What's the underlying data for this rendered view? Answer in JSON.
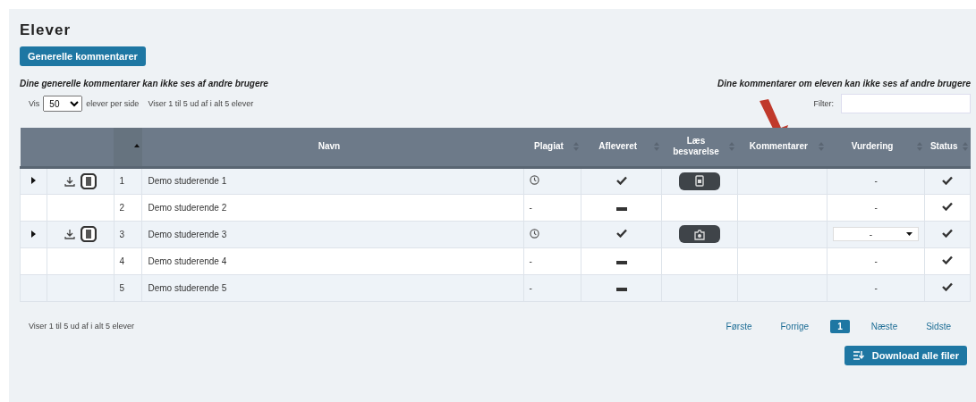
{
  "title": "Elever",
  "general_comments_button": "Generelle kommentarer",
  "notes": {
    "left": "Dine generelle kommentarer kan ikke ses af andre brugere",
    "right": "Dine kommentarer om eleven kan ikke ses af andre brugere"
  },
  "length": {
    "prefix": "Vis",
    "value": "50",
    "suffix": "elever per side",
    "info": "Viser 1 til 5 ud af i alt 5 elever"
  },
  "filter": {
    "label": "Filter:"
  },
  "annotation": {
    "kind": "arrow"
  },
  "columns": [
    {
      "sortable": true,
      "sorted": true
    },
    {
      "label": "Navn",
      "sortable": false
    },
    {
      "label": "Plagiat",
      "sortable": true,
      "sorted": false
    },
    {
      "label": "Afleveret",
      "sortable": true,
      "sorted": false
    },
    {
      "label": "Læs besvarelse",
      "sortable": true,
      "sorted": false
    },
    {
      "label": "Kommentarer",
      "sortable": true,
      "sorted": false
    },
    {
      "label": "Vurdering",
      "sortable": true,
      "sorted": false
    },
    {
      "label": "Status",
      "sortable": true,
      "sorted": false
    }
  ],
  "rows": [
    {
      "expandable": true,
      "files": true,
      "number": "1",
      "name": "Demo studerende 1",
      "plagiat": {
        "kind": "clock"
      },
      "afleveret": {
        "kind": "check"
      },
      "answer": {
        "kind": "document"
      },
      "vurdering": {
        "kind": "text",
        "value": "-"
      },
      "status": {
        "kind": "check"
      }
    },
    {
      "expandable": false,
      "files": false,
      "number": "2",
      "name": "Demo studerende 2",
      "plagiat": {
        "kind": "text",
        "value": "-"
      },
      "afleveret": {
        "kind": "dash"
      },
      "vurdering": {
        "kind": "text",
        "value": "-"
      },
      "status": {
        "kind": "check"
      }
    },
    {
      "expandable": true,
      "files": true,
      "number": "3",
      "name": "Demo studerende 3",
      "plagiat": {
        "kind": "clock"
      },
      "afleveret": {
        "kind": "check"
      },
      "answer": {
        "kind": "camera"
      },
      "vurdering": {
        "kind": "select",
        "value": "-"
      },
      "status": {
        "kind": "check"
      }
    },
    {
      "expandable": false,
      "files": false,
      "number": "4",
      "name": "Demo studerende 4",
      "plagiat": {
        "kind": "text",
        "value": "-"
      },
      "afleveret": {
        "kind": "dash"
      },
      "vurdering": {
        "kind": "text",
        "value": "-"
      },
      "status": {
        "kind": "check"
      }
    },
    {
      "expandable": false,
      "files": false,
      "number": "5",
      "name": "Demo studerende 5",
      "plagiat": {
        "kind": "text",
        "value": "-"
      },
      "afleveret": {
        "kind": "dash"
      },
      "vurdering": {
        "kind": "text",
        "value": "-"
      },
      "status": {
        "kind": "check"
      }
    }
  ],
  "footer_info": "Viser 1 til 5 ud af i alt 5 elever",
  "pagination": [
    {
      "label": "Første",
      "selected": false
    },
    {
      "label": "Forrige",
      "selected": false
    },
    {
      "label": "1",
      "selected": true
    },
    {
      "label": "Næste",
      "selected": false
    },
    {
      "label": "Sidste",
      "selected": false
    }
  ],
  "download_button": "Download alle filer"
}
